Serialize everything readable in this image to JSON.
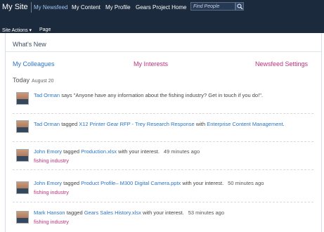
{
  "nav": {
    "site_title": "My Site",
    "links": [
      "My Newsfeed",
      "My Content",
      "My Profile",
      "Gears Project Home"
    ],
    "search_placeholder": "Find People",
    "site_actions": "Site Actions",
    "page": "Page"
  },
  "main": {
    "heading": "What's New",
    "tabs": [
      "My Colleagues",
      "My Interests",
      "Newsfeed Settings"
    ],
    "today_label": "Today",
    "today_date": "August 20"
  },
  "feed": [
    {
      "actor": "Tad Orman",
      "verb": " says \"Anyone have any information about the fishing industry? Get in touch if you do!\".",
      "item": "",
      "rest": "",
      "link2": "",
      "tail": "",
      "time": "",
      "tag": ""
    },
    {
      "actor": "Tad Orman",
      "verb": " tagged ",
      "item": "X12 Printer Gear RFP - Trey Research Response",
      "rest": " with ",
      "link2": "Enterprise Content Management",
      "tail": ".",
      "time": "",
      "tag": ""
    },
    {
      "actor": "John Emory",
      "verb": " tagged ",
      "item": "Production.xlsx",
      "rest": " with your interest.",
      "link2": "",
      "tail": "",
      "time": "49 minutes ago",
      "tag": "fishing industry"
    },
    {
      "actor": "John Emory",
      "verb": " tagged ",
      "item": "Product Profile– M300 Digital Camera.pptx",
      "rest": " with your interest.",
      "link2": "",
      "tail": "",
      "time": "50 minutes ago",
      "tag": "fishing industry"
    },
    {
      "actor": "Mark Hanson",
      "verb": " tagged ",
      "item": "Gears Sales History.xlsx",
      "rest": " with your interest.",
      "link2": "",
      "tail": "",
      "time": "53 minutes ago",
      "tag": "fishing industry"
    }
  ]
}
